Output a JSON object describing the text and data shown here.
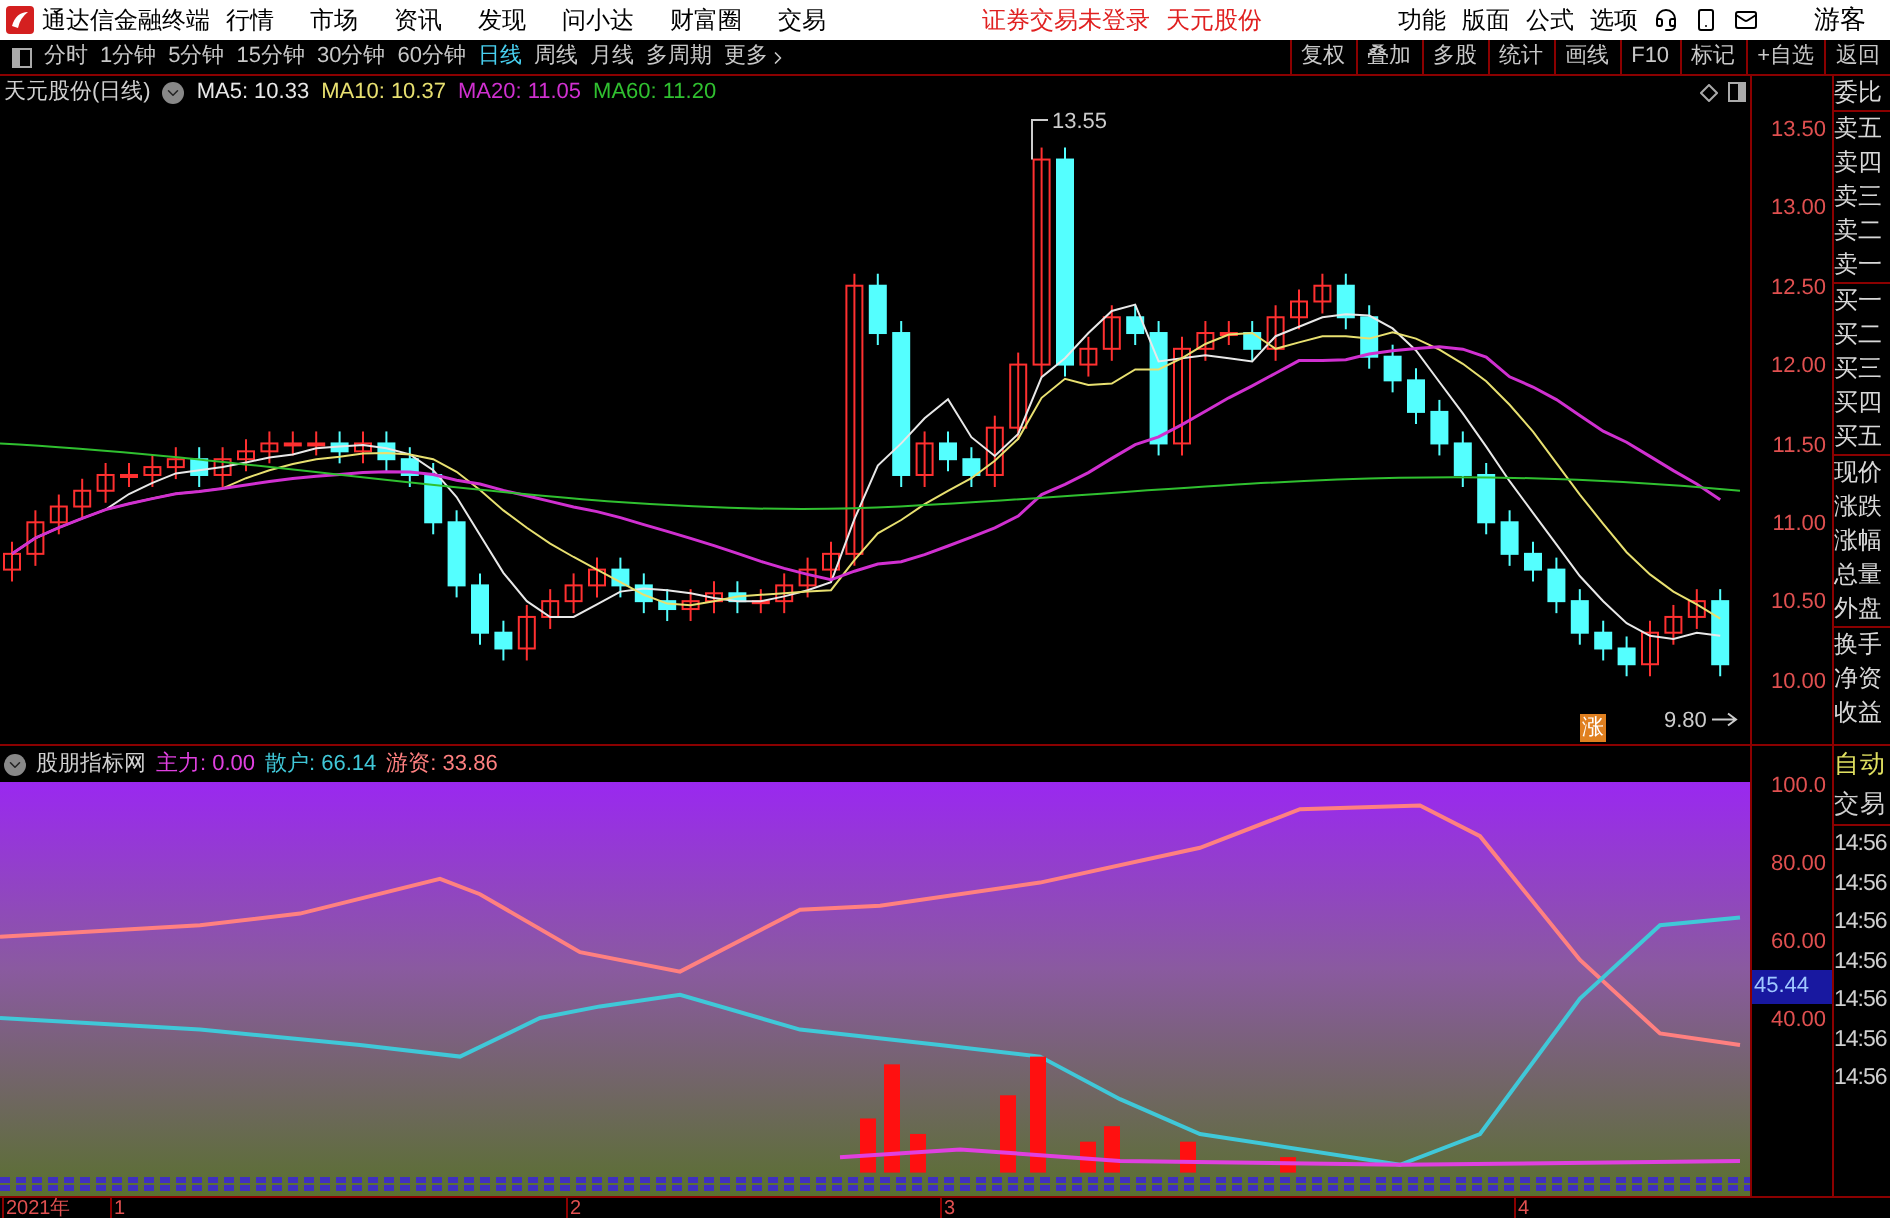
{
  "app": {
    "title": "通达信金融终端",
    "menu": [
      "行情",
      "市场",
      "资讯",
      "发现",
      "问小达",
      "财富圈",
      "交易"
    ],
    "notice": "证券交易未登录",
    "stock": "天元股份",
    "right_menu": [
      "功能",
      "版面",
      "公式",
      "选项"
    ],
    "user": "游客"
  },
  "toolbar": {
    "periods": [
      {
        "label": "分时",
        "selected": false
      },
      {
        "label": "1分钟",
        "selected": false
      },
      {
        "label": "5分钟",
        "selected": false
      },
      {
        "label": "15分钟",
        "selected": false
      },
      {
        "label": "30分钟",
        "selected": false
      },
      {
        "label": "60分钟",
        "selected": false
      },
      {
        "label": "日线",
        "selected": true
      },
      {
        "label": "周线",
        "selected": false
      },
      {
        "label": "月线",
        "selected": false
      },
      {
        "label": "多周期",
        "selected": false
      },
      {
        "label": "更多",
        "selected": false
      }
    ],
    "buttons": [
      "复权",
      "叠加",
      "多股",
      "统计",
      "画线",
      "F10",
      "标记",
      "+自选",
      "返回"
    ]
  },
  "price_chart": {
    "title": "天元股份(日线)",
    "averages": [
      {
        "label": "MA5: 10.33",
        "color": "#e8e8e8"
      },
      {
        "label": "MA10: 10.37",
        "color": "#e8e070"
      },
      {
        "label": "MA20: 11.05",
        "color": "#d030d0"
      },
      {
        "label": "MA60: 11.20",
        "color": "#30c030"
      }
    ],
    "axis": [
      "13.50",
      "13.00",
      "12.50",
      "12.00",
      "11.50",
      "11.00",
      "10.50",
      "10.00"
    ],
    "high_label": "13.55",
    "low_label": "9.80",
    "badge": "涨"
  },
  "quote_panel": [
    [
      "委比"
    ],
    [
      "卖五",
      "卖四",
      "卖三",
      "卖二",
      "卖一"
    ],
    [
      "买一",
      "买二",
      "买三",
      "买四",
      "买五"
    ],
    [
      "现价",
      "涨跌",
      "涨幅",
      "总量",
      "外盘"
    ],
    [
      "换手",
      "净资",
      "收益"
    ]
  ],
  "indicator": {
    "name": "股朋指标网",
    "values": [
      {
        "label": "主力: 0.00",
        "color": "#e040e0"
      },
      {
        "label": "散户: 66.14",
        "color": "#40c8d8"
      },
      {
        "label": "游资: 33.86",
        "color": "#ff8080"
      }
    ],
    "axis": [
      "100.0",
      "80.00",
      "60.00",
      "40.00"
    ],
    "current": "45.44"
  },
  "trade_panel": {
    "header": [
      "自动",
      "交易"
    ],
    "times": [
      "14:56",
      "14:56",
      "14:56",
      "14:56",
      "14:56",
      "14:56",
      "14:56"
    ]
  },
  "date_axis": [
    "2021年",
    "1",
    "2",
    "3",
    "4"
  ]
}
